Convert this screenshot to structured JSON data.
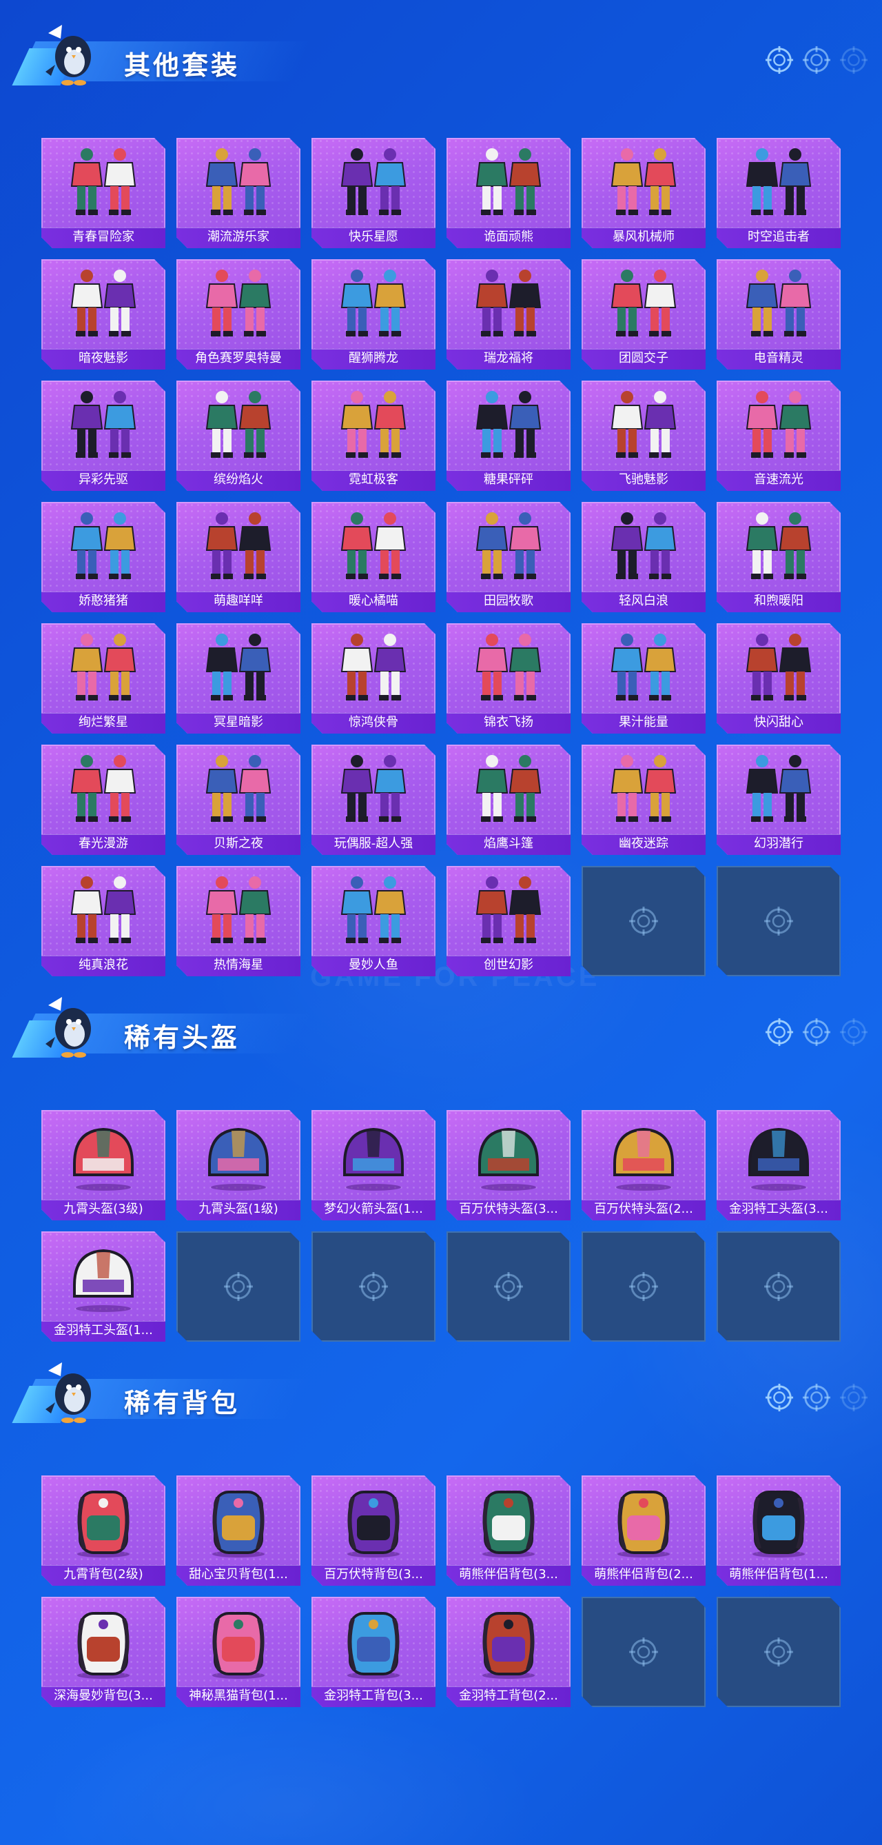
{
  "sections": [
    {
      "key": "outfits",
      "title": "其他套装",
      "items": [
        "青春冒险家",
        "潮流游乐家",
        "快乐星愿",
        "诡面顽熊",
        "暴风机械师",
        "时空追击者",
        "暗夜魅影",
        "角色赛罗奥特曼",
        "醒狮腾龙",
        "瑞龙福将",
        "团圆交子",
        "电音精灵",
        "异彩先驱",
        "缤纷焰火",
        "霓虹极客",
        "糖果砰砰",
        "飞驰魅影",
        "音速流光",
        "娇憨猪猪",
        "萌趣咩咩",
        "暖心橘喵",
        "田园牧歌",
        "轻风白浪",
        "和煦暖阳",
        "绚烂繁星",
        "冥星暗影",
        "惊鸿侠骨",
        "锦衣飞扬",
        "果汁能量",
        "快闪甜心",
        "春光漫游",
        "贝斯之夜",
        "玩偶服-超人强",
        "焰鹰斗篷",
        "幽夜迷踪",
        "幻羽潜行",
        "纯真浪花",
        "热情海星",
        "曼妙人鱼",
        "创世幻影"
      ],
      "empty_slots": 2
    },
    {
      "key": "helmets",
      "title": "稀有头盔",
      "items": [
        "九霄头盔(3级)",
        "九霄头盔(1级)",
        "梦幻火箭头盔(1...",
        "百万伏特头盔(3...",
        "百万伏特头盔(2...",
        "金羽特工头盔(3...",
        "金羽特工头盔(1..."
      ],
      "empty_slots": 5
    },
    {
      "key": "backpacks",
      "title": "稀有背包",
      "items": [
        "九霄背包(2级)",
        "甜心宝贝背包(1...",
        "百万伏特背包(3...",
        "萌熊伴侣背包(3...",
        "萌熊伴侣背包(2...",
        "萌熊伴侣背包(1...",
        "深海曼妙背包(3...",
        "神秘黑猫背包(1...",
        "金羽特工背包(3...",
        "金羽特工背包(2..."
      ],
      "empty_slots": 2
    }
  ],
  "watermark": "GAME FOR PEACE",
  "colors": {
    "background": "#0f5be0",
    "tile_purple": "#a85cee",
    "label_bar": "#7a2fe0",
    "empty_tile": "#274c83"
  },
  "icons": {
    "mascot": "penguin-mascot-icon",
    "deco": "crosshair-icon",
    "empty": "crosshair-icon"
  }
}
